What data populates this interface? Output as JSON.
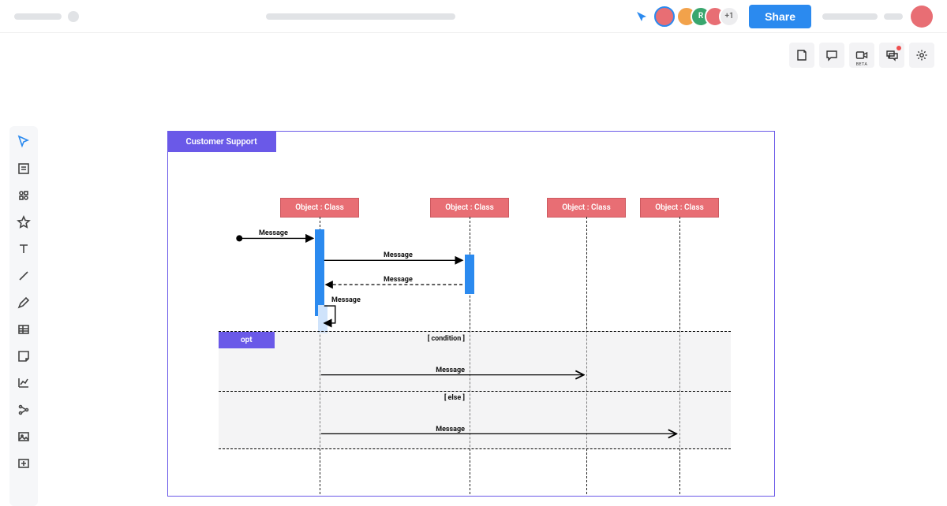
{
  "appbar": {
    "share_label": "Share",
    "more_count": "+1",
    "cursor_color": "#2b8aef",
    "avatars": {
      "own": {
        "bg": "#e86e74",
        "ring": "#2b8aef"
      },
      "c1": {
        "bg": "#f2a24b"
      },
      "c2": {
        "bg": "#39a66e",
        "letter": "R"
      },
      "c3": {
        "bg": "#e86e74"
      }
    }
  },
  "rightbar": {
    "beta_label": "BETA"
  },
  "diagram": {
    "frame_title": "Customer Support",
    "lifelines": [
      {
        "label": "Object : Class"
      },
      {
        "label": "Object : Class"
      },
      {
        "label": "Object : Class"
      },
      {
        "label": "Object : Class"
      }
    ],
    "messages": {
      "found": "Message",
      "sync1": "Message",
      "reply1": "Message",
      "self1": "Message",
      "opt_tag": "opt",
      "condition": "[ condition ]",
      "else": "[ else ]",
      "opt_msg1": "Message",
      "opt_msg2": "Message"
    }
  }
}
